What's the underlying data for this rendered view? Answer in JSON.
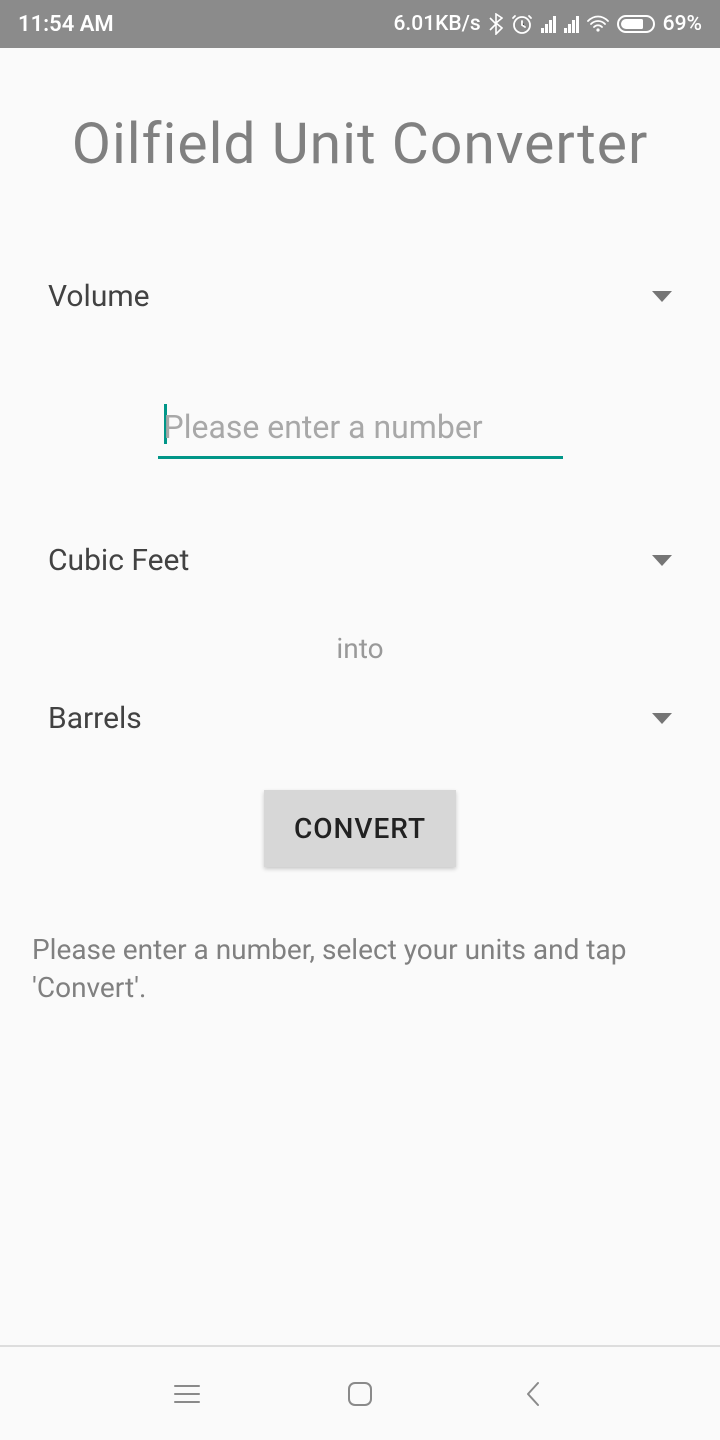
{
  "status_bar": {
    "time": "11:54 AM",
    "data_rate": "6.01KB/s",
    "battery_pct": "69%"
  },
  "app": {
    "title": "Oilfield Unit Converter"
  },
  "category_dropdown": {
    "selected": "Volume"
  },
  "number_input": {
    "value": "",
    "placeholder": "Please enter a number"
  },
  "from_unit_dropdown": {
    "selected": "Cubic Feet"
  },
  "into_label": "into",
  "to_unit_dropdown": {
    "selected": "Barrels"
  },
  "convert_button": {
    "label": "CONVERT"
  },
  "helper_text": "Please enter a number, select your units and tap 'Convert'."
}
